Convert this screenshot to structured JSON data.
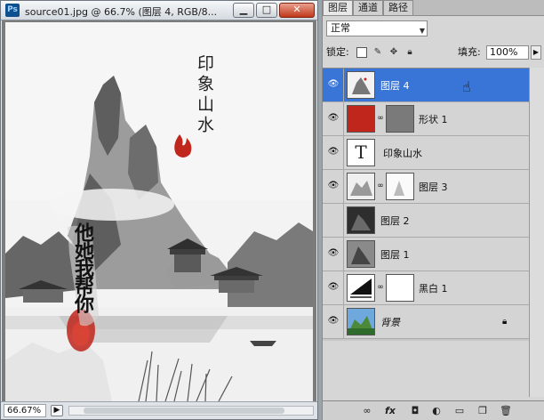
{
  "document_window": {
    "app_badge": "Ps",
    "title": "source01.jpg @ 66.7% (图层 4, RGB/8...",
    "buttons": {
      "minimize": "▁",
      "restore": "□",
      "close": "✕"
    },
    "artwork_calligraphy_top": "印象山水",
    "artwork_calligraphy_left": "他她我帮你",
    "status": {
      "zoom": "66.67%"
    }
  },
  "layers_panel": {
    "tabs": [
      "图层",
      "通道",
      "路径"
    ],
    "blend_mode": "正常",
    "lock_label": "锁定:",
    "fill_label": "填充:",
    "fill_value": "100%",
    "layers": [
      {
        "name": "图层 4",
        "selected": true,
        "visible": true,
        "thumb": "landscape"
      },
      {
        "name": "形状 1",
        "selected": false,
        "visible": true,
        "thumb": "red"
      },
      {
        "name": "印象山水",
        "selected": false,
        "visible": true,
        "thumb": "text"
      },
      {
        "name": "图层 3",
        "selected": false,
        "visible": true,
        "thumb": "landscape"
      },
      {
        "name": "图层 2",
        "selected": false,
        "visible": false,
        "thumb": "dark"
      },
      {
        "name": "图层 1",
        "selected": false,
        "visible": true,
        "thumb": "gray"
      },
      {
        "name": "黑白 1",
        "selected": false,
        "visible": true,
        "thumb": "adjust"
      },
      {
        "name": "背景",
        "selected": false,
        "visible": true,
        "thumb": "color",
        "locked": true
      }
    ],
    "bottom_icons": [
      "link-icon",
      "fx-icon",
      "mask-icon",
      "adjustment-icon",
      "folder-icon",
      "new-layer-icon",
      "trash-icon"
    ]
  },
  "colors": {
    "selected_row": "#3875d7",
    "seal_red": "#c0261c",
    "mask_gray": "#7a7a7a"
  }
}
